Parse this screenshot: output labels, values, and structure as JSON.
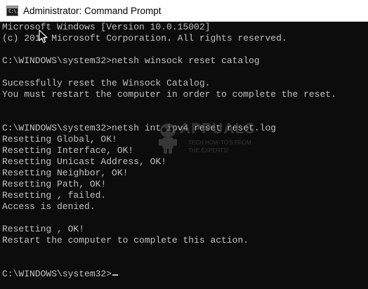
{
  "window": {
    "title": "Administrator: Command Prompt",
    "icon": "command-prompt-icon",
    "icon_glyph": "C:\\."
  },
  "console": {
    "lines": [
      "Microsoft Windows [Version 10.0.15002]",
      "(c) 2016 Microsoft Corporation. All rights reserved.",
      "",
      "C:\\WINDOWS\\system32>netsh winsock reset catalog",
      "",
      "Sucessfully reset the Winsock Catalog.",
      "You must restart the computer in order to complete the reset.",
      "",
      "",
      "C:\\WINDOWS\\system32>netsh int ipv4 reset reset.log",
      "Resetting Global, OK!",
      "Resetting Interface, OK!",
      "Resetting Unicast Address, OK!",
      "Resetting Neighbor, OK!",
      "Resetting Path, OK!",
      "Resetting , failed.",
      "Access is denied.",
      "",
      "Resetting , OK!",
      "Restart the computer to complete this action.",
      "",
      "",
      "C:\\WINDOWS\\system32>"
    ],
    "foreground": "#c0c0c0",
    "background": "#0c0c0c"
  },
  "watermark": {
    "brand": "APPUALS",
    "tagline_1": "TECH HOW-TO'S FROM",
    "tagline_2": "THE EXPERTS!"
  }
}
